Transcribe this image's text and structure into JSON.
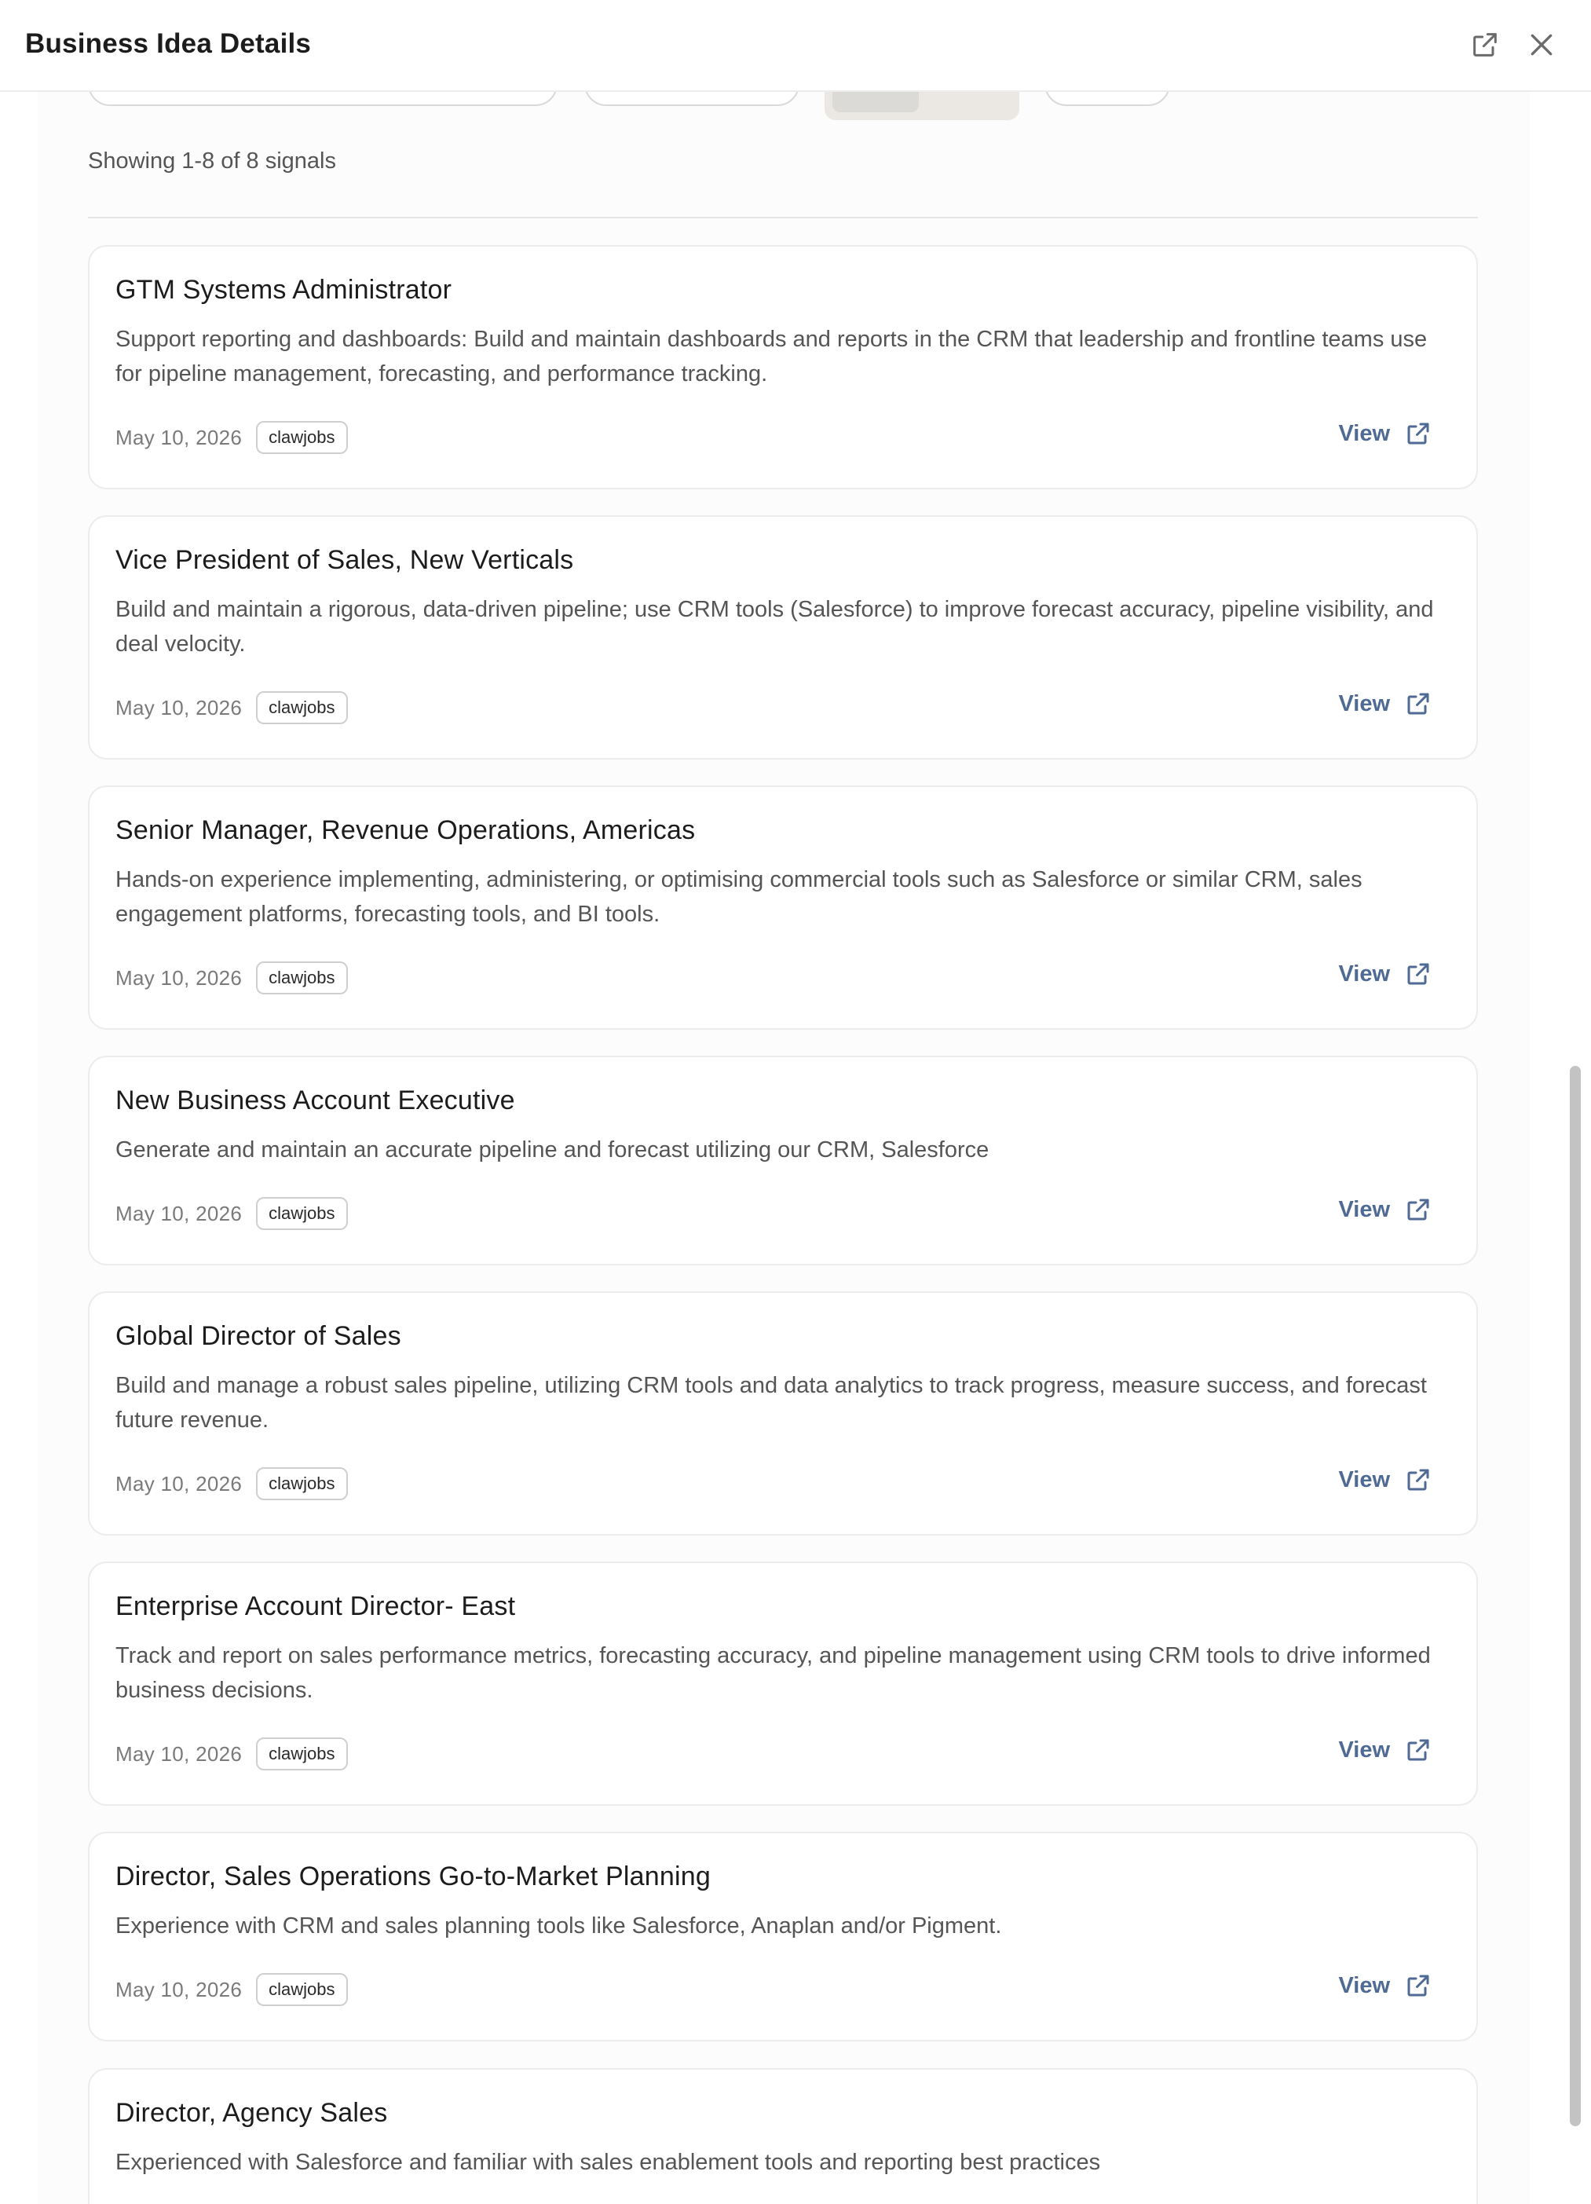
{
  "header": {
    "title": "Business Idea Details",
    "popout_icon": "external-link-icon",
    "close_icon": "close-icon"
  },
  "toolbar": {
    "view_toggle_icons": [
      "list-view-icon",
      "grid-view-icon"
    ]
  },
  "results": {
    "count_text": "Showing 1-8 of 8 signals"
  },
  "signals": [
    {
      "title": "GTM Systems Administrator",
      "description": "Support reporting and dashboards: Build and maintain dashboards and reports in the CRM that leadership and frontline teams use for pipeline management, forecasting, and performance tracking.",
      "date": "May 10, 2026",
      "source": "clawjobs",
      "view_label": "View"
    },
    {
      "title": "Vice President of Sales, New Verticals",
      "description": "Build and maintain a rigorous, data-driven pipeline; use CRM tools (Salesforce) to improve forecast accuracy, pipeline visibility, and deal velocity.",
      "date": "May 10, 2026",
      "source": "clawjobs",
      "view_label": "View"
    },
    {
      "title": "Senior Manager, Revenue Operations, Americas",
      "description": "Hands-on experience implementing, administering, or optimising commercial tools such as Salesforce or similar CRM, sales engagement platforms, forecasting tools, and BI tools.",
      "date": "May 10, 2026",
      "source": "clawjobs",
      "view_label": "View"
    },
    {
      "title": "New Business Account Executive",
      "description": "Generate and maintain an accurate pipeline and forecast utilizing our CRM, Salesforce",
      "date": "May 10, 2026",
      "source": "clawjobs",
      "view_label": "View"
    },
    {
      "title": "Global Director of Sales",
      "description": "Build and manage a robust sales pipeline, utilizing CRM tools and data analytics to track progress, measure success, and forecast future revenue.",
      "date": "May 10, 2026",
      "source": "clawjobs",
      "view_label": "View"
    },
    {
      "title": "Enterprise Account Director- East",
      "description": "Track and report on sales performance metrics, forecasting accuracy, and pipeline management using CRM tools to drive informed business decisions.",
      "date": "May 10, 2026",
      "source": "clawjobs",
      "view_label": "View"
    },
    {
      "title": "Director, Sales Operations Go-to-Market Planning",
      "description": "Experience with CRM and sales planning tools like Salesforce, Anaplan and/or Pigment.",
      "date": "May 10, 2026",
      "source": "clawjobs",
      "view_label": "View"
    },
    {
      "title": "Director, Agency Sales",
      "description": "Experienced with Salesforce and familiar with sales enablement tools and reporting best practices",
      "date": "",
      "source": "",
      "view_label": ""
    }
  ],
  "colors": {
    "accent_link": "#4f6a94",
    "card_border": "#ececec",
    "muted_text": "#555555"
  }
}
